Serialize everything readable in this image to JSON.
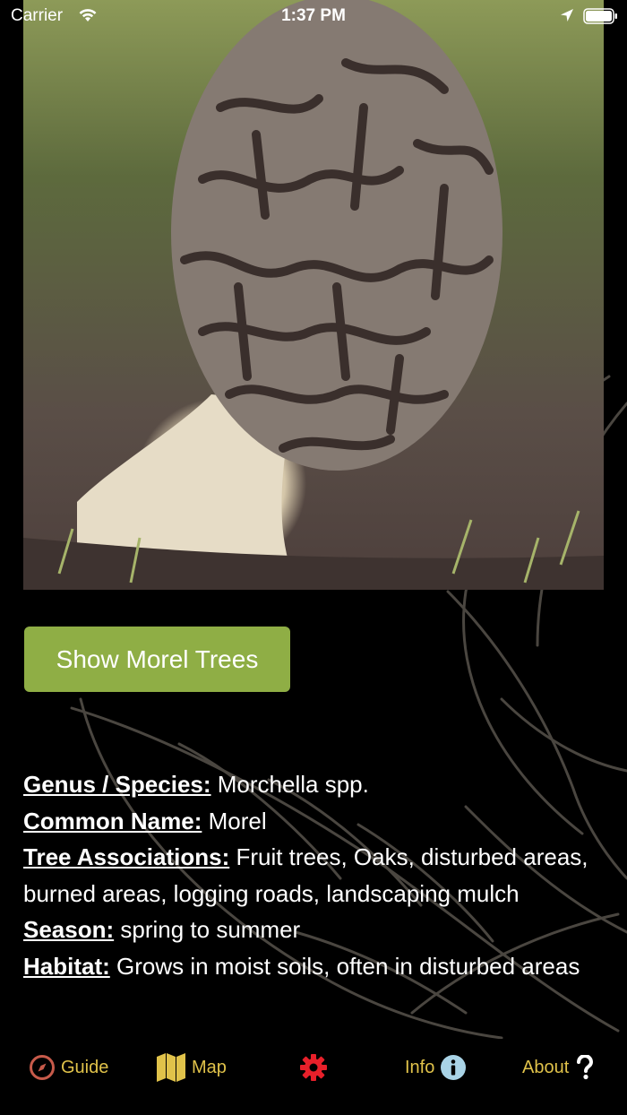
{
  "status_bar": {
    "carrier": "Carrier",
    "time": "1:37 PM"
  },
  "photo": {
    "icon": "morel-mushroom-photo"
  },
  "show_trees_button": {
    "label": "Show Morel Trees"
  },
  "details": [
    {
      "label": "Genus / Species:",
      "value": " Morchella spp."
    },
    {
      "label": "Common Name:",
      "value": " Morel"
    },
    {
      "label": "Tree Associations:",
      "value": " Fruit trees, Oaks, disturbed areas, burned areas, logging roads, landscaping mulch"
    },
    {
      "label": "Season:",
      "value": " spring to summer"
    },
    {
      "label": "Habitat:",
      "value": " Grows in moist soils, often in disturbed areas"
    }
  ],
  "tabbar": {
    "guide": {
      "label": "Guide",
      "icon": "compass-icon"
    },
    "map": {
      "label": "Map",
      "icon": "map-icon"
    },
    "settings": {
      "icon": "gear-icon"
    },
    "info": {
      "label": "Info",
      "icon": "info-icon"
    },
    "about": {
      "label": "About",
      "icon": "question-icon"
    }
  },
  "colors": {
    "accent": "#e0c24a",
    "button": "#8fae45",
    "settings_icon": "#e8202a",
    "guide_icon": "#c75a4a",
    "info_icon": "#a9d3e6"
  }
}
